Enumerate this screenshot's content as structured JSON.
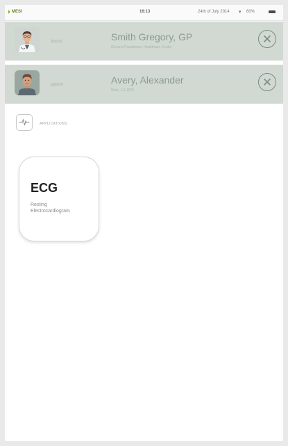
{
  "status_bar": {
    "brand": "MESI",
    "time": "16:13",
    "date": "24th of July 2014",
    "battery": "60%",
    "wifi_icon": "wifi-icon"
  },
  "physician": {
    "role": "doctor",
    "name": "Smith Gregory, GP",
    "sub": "General Practitioner, Healthcare Center"
  },
  "patient": {
    "role": "patient",
    "name": "Avery, Alexander",
    "sub": "Male, 1.1.1975"
  },
  "applications": {
    "label": "APPLICATIONS"
  },
  "app_tile": {
    "title": "ECG",
    "desc_line1": "Resting",
    "desc_line2": "Electrocardiogram"
  },
  "colors": {
    "row_bg": "#d1d9d2",
    "brand_green": "#8db63c"
  }
}
